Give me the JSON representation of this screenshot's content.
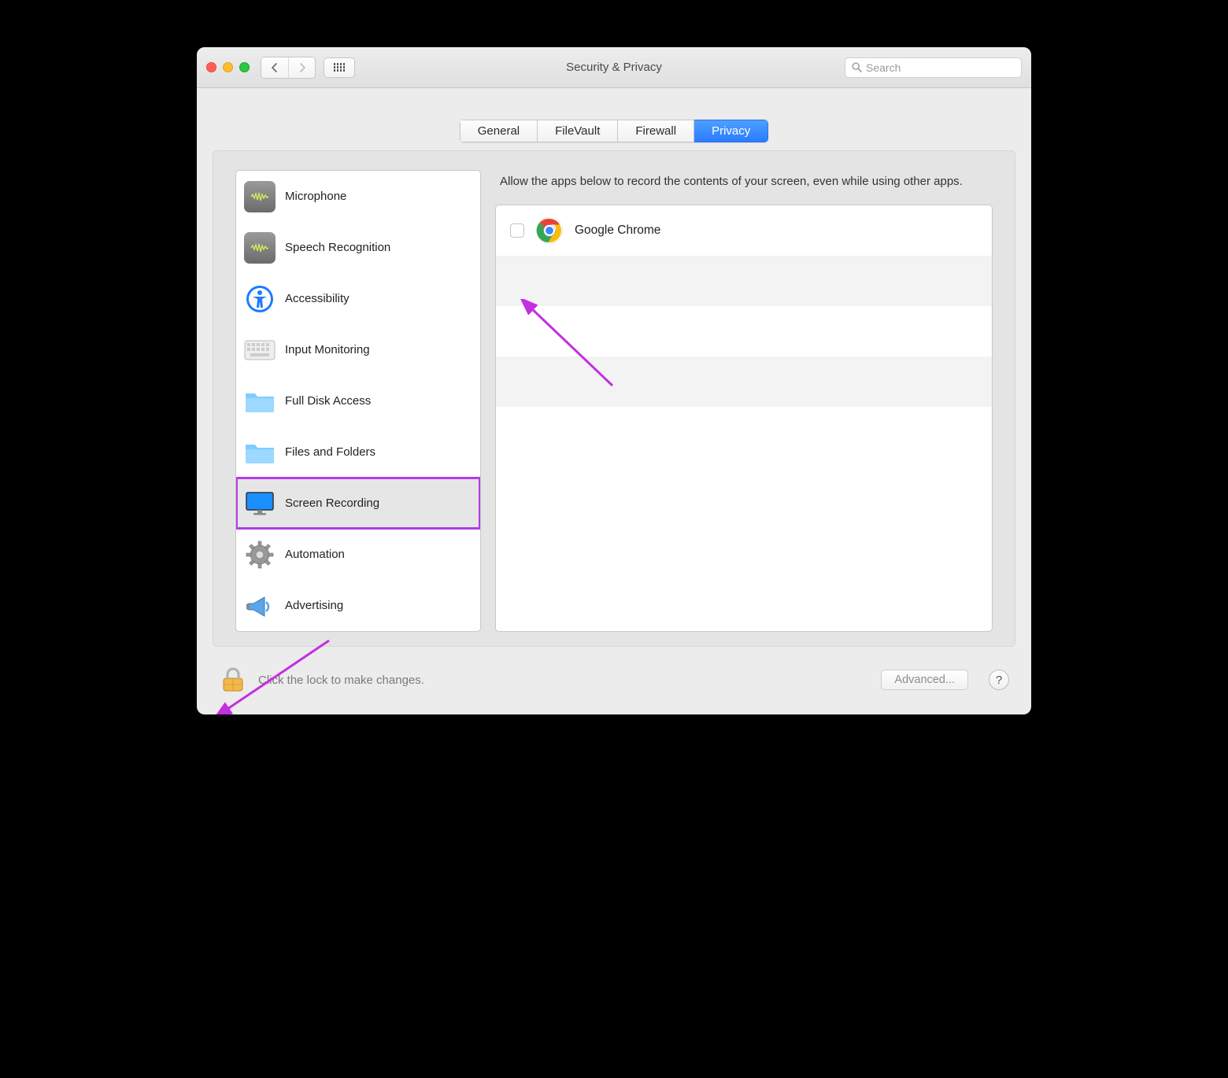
{
  "window": {
    "title": "Security & Privacy",
    "search_placeholder": "Search"
  },
  "tabs": [
    {
      "label": "General",
      "active": false
    },
    {
      "label": "FileVault",
      "active": false
    },
    {
      "label": "Firewall",
      "active": false
    },
    {
      "label": "Privacy",
      "active": true
    }
  ],
  "sidebar": {
    "items": [
      {
        "label": "Microphone",
        "icon": "microphone"
      },
      {
        "label": "Speech Recognition",
        "icon": "speech"
      },
      {
        "label": "Accessibility",
        "icon": "accessibility"
      },
      {
        "label": "Input Monitoring",
        "icon": "keyboard"
      },
      {
        "label": "Full Disk Access",
        "icon": "folder"
      },
      {
        "label": "Files and Folders",
        "icon": "folder"
      },
      {
        "label": "Screen Recording",
        "icon": "display",
        "selected": true
      },
      {
        "label": "Automation",
        "icon": "gear"
      },
      {
        "label": "Advertising",
        "icon": "megaphone"
      }
    ]
  },
  "detail": {
    "description": "Allow the apps below to record the contents of your screen, even while using other apps.",
    "apps": [
      {
        "name": "Google Chrome",
        "checked": false
      }
    ]
  },
  "footer": {
    "lock_text": "Click the lock to make changes.",
    "advanced_label": "Advanced...",
    "help_label": "?"
  },
  "annotations": {
    "highlight_color": "#b33be8"
  }
}
